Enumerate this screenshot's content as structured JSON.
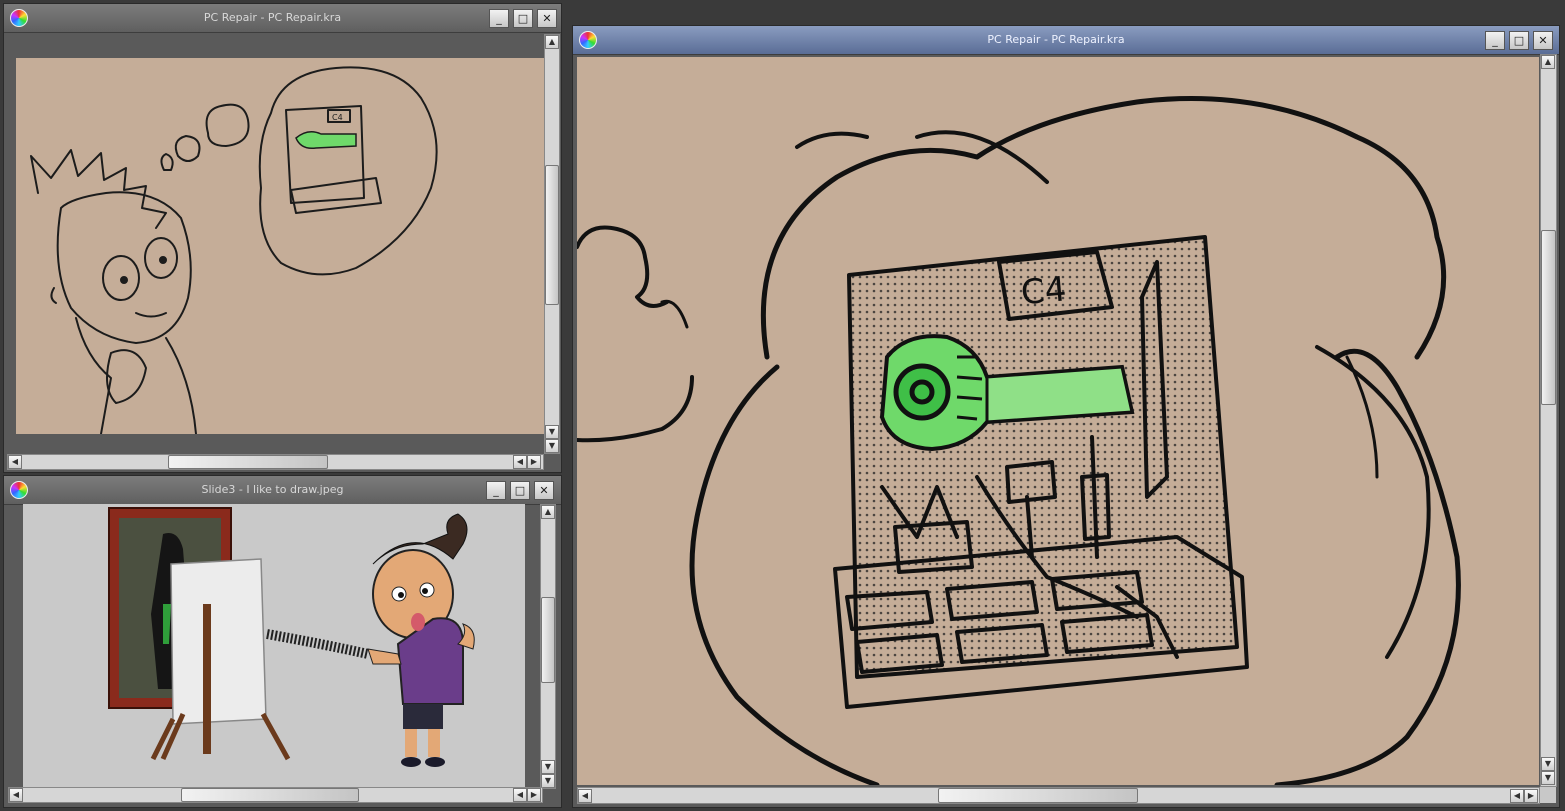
{
  "windows": {
    "top_left": {
      "title": "PC Repair - PC Repair.kra"
    },
    "bottom_left": {
      "title": "Slide3 - I like to draw.jpeg"
    },
    "right": {
      "title": "PC Repair - PC Repair.kra"
    }
  },
  "controls": {
    "minimize": "_",
    "maximize": "□",
    "close": "✕"
  },
  "artwork": {
    "board_label": "C4"
  },
  "colors": {
    "canvas_tan": "#c5ad98",
    "photo_gray": "#c9c9c9",
    "accent_green": "#6fd96a",
    "active_title": "#5a6d96"
  },
  "icons": [
    "app-logo-icon",
    "minimize-icon",
    "maximize-icon",
    "close-icon",
    "scroll-up-icon",
    "scroll-down-icon",
    "scroll-left-icon",
    "scroll-right-icon"
  ]
}
